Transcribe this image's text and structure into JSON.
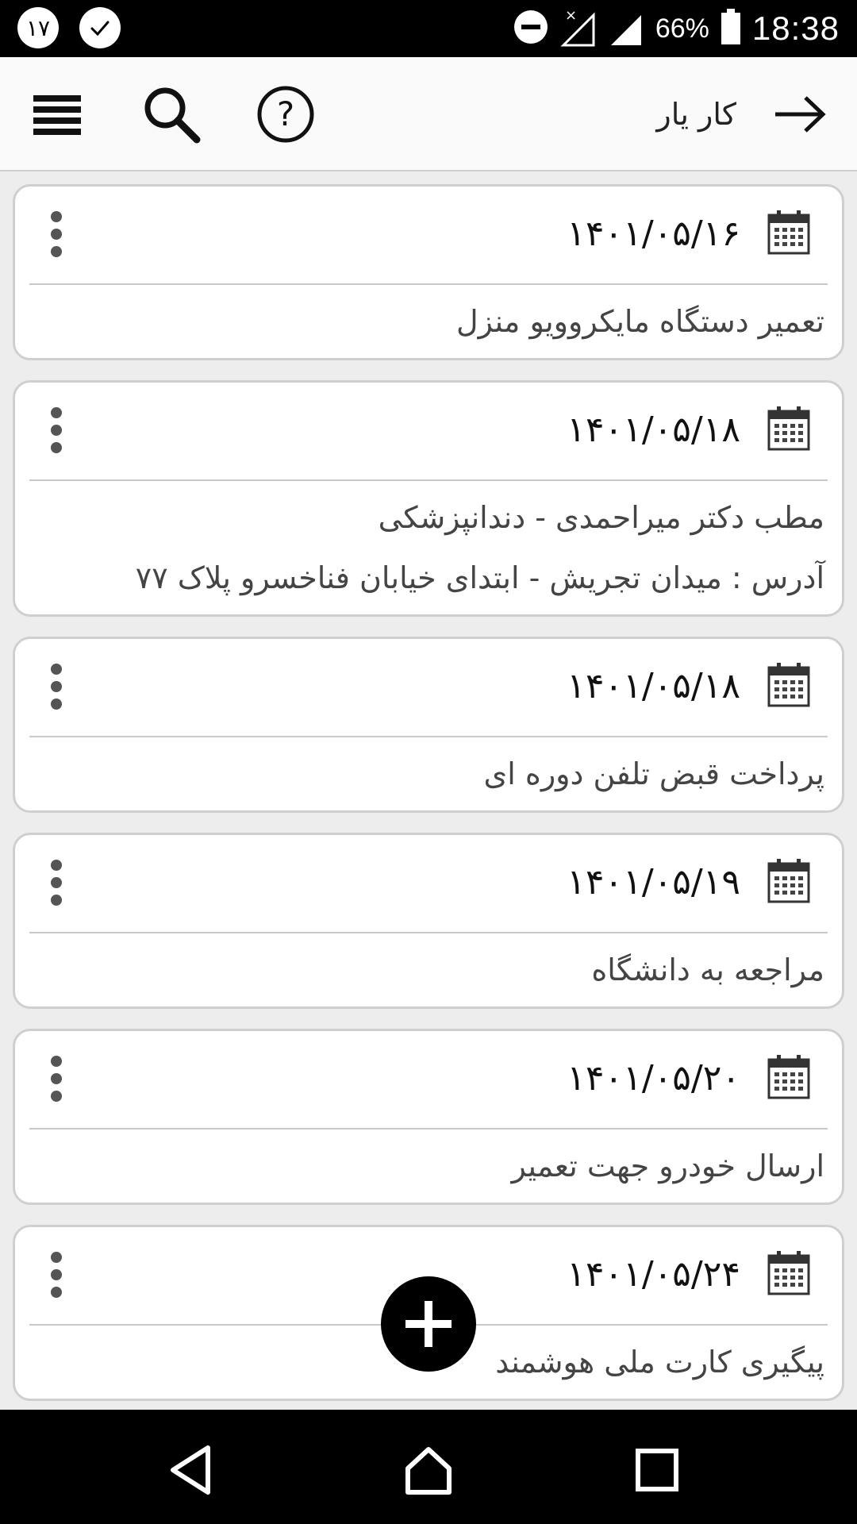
{
  "status_bar": {
    "left_badge": "۱۷",
    "battery_percent": "66%",
    "time": "18:38"
  },
  "app_bar": {
    "title": "کار یار",
    "icons": [
      "menu-icon",
      "search-icon",
      "help-icon",
      "back-arrow-icon"
    ]
  },
  "tasks": [
    {
      "date": "۱۴۰۱/۰۵/۱۶",
      "lines": [
        "تعمیر دستگاه مایکروویو منزل"
      ]
    },
    {
      "date": "۱۴۰۱/۰۵/۱۸",
      "lines": [
        "مطب دکتر میراحمدی - دندانپزشکی",
        "آدرس : میدان تجریش - ابتدای خیابان فناخسرو پلاک ۷۷"
      ]
    },
    {
      "date": "۱۴۰۱/۰۵/۱۸",
      "lines": [
        "پرداخت قبض تلفن دوره ای"
      ]
    },
    {
      "date": "۱۴۰۱/۰۵/۱۹",
      "lines": [
        "مراجعه به دانشگاه"
      ]
    },
    {
      "date": "۱۴۰۱/۰۵/۲۰",
      "lines": [
        "ارسال خودرو جهت تعمیر"
      ]
    },
    {
      "date": "۱۴۰۱/۰۵/۲۴",
      "lines": [
        "پیگیری کارت ملی هوشمند"
      ]
    }
  ],
  "fab": {
    "icon": "plus-icon"
  },
  "nav_bar": {
    "icons": [
      "back-triangle-icon",
      "home-icon",
      "recents-icon"
    ]
  }
}
